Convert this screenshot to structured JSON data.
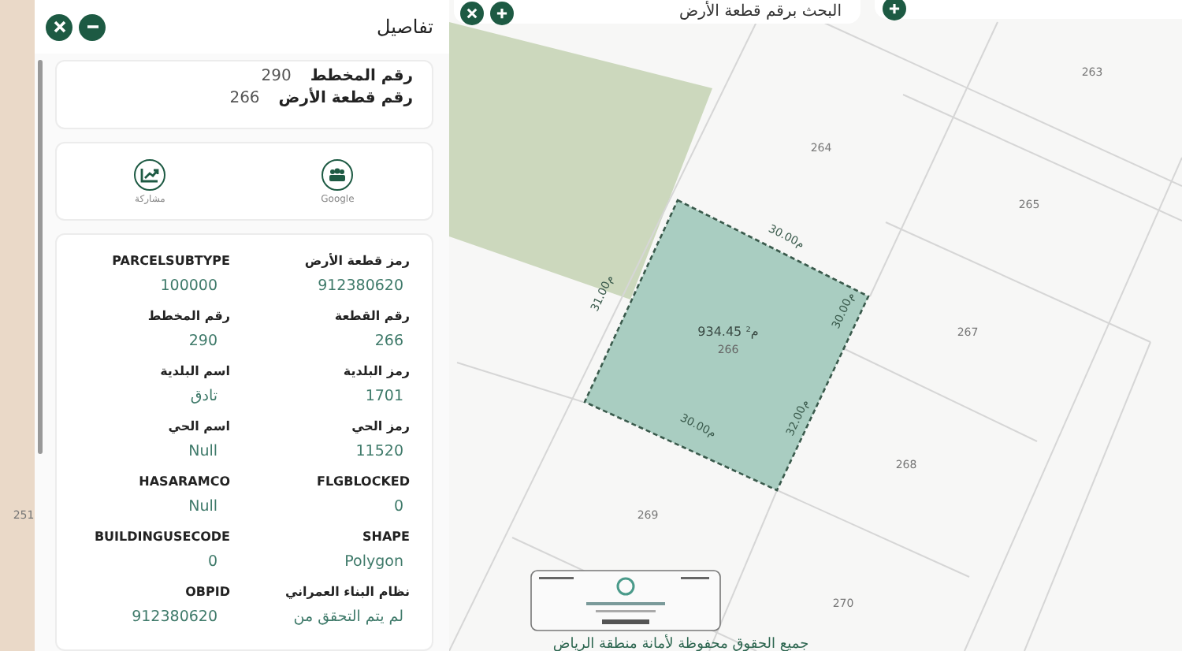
{
  "search_bar": {
    "title": "البحث برقم قطعة الأرض"
  },
  "map": {
    "parcels": [
      {
        "label": "263"
      },
      {
        "label": "264"
      },
      {
        "label": "265"
      },
      {
        "label": "267"
      },
      {
        "label": "268"
      },
      {
        "label": "269"
      },
      {
        "label": "270"
      },
      {
        "label": "251"
      }
    ],
    "selected_parcel": {
      "label": "266",
      "area": "934.45 م²",
      "edges": [
        "30.00م",
        "30.00م",
        "32.00م",
        "30.00م",
        "31.00م"
      ]
    },
    "footer": "جميع الحقوق محفوظة لأمانة منطقة الرياض"
  },
  "panel": {
    "title": "تفاصيل",
    "summary": [
      {
        "label": "رقم المخطط",
        "value": "290"
      },
      {
        "label": "رقم قطعة الأرض",
        "value": "266"
      }
    ],
    "actions": [
      {
        "label": "Google"
      },
      {
        "label": "مشاركة"
      }
    ],
    "attributes": [
      {
        "label": "رمز قطعة الأرض",
        "value": "912380620"
      },
      {
        "label": "PARCELSUBTYPE",
        "value": "100000"
      },
      {
        "label": "رقم القطعة",
        "value": "266"
      },
      {
        "label": "رقم المخطط",
        "value": "290"
      },
      {
        "label": "رمز البلدية",
        "value": "1701"
      },
      {
        "label": "اسم البلدية",
        "value": "تادق"
      },
      {
        "label": "رمز الحي",
        "value": "11520"
      },
      {
        "label": "اسم الحي",
        "value": "Null"
      },
      {
        "label": "FLGBLOCKED",
        "value": "0"
      },
      {
        "label": "HASARAMCO",
        "value": "Null"
      },
      {
        "label": "SHAPE",
        "value": "Polygon"
      },
      {
        "label": "BUILDINGUSECODE",
        "value": "0"
      },
      {
        "label": "نظام البناء العمراني",
        "value": "لم يتم التحقق من"
      },
      {
        "label": "OBPID",
        "value": "912380620"
      }
    ]
  }
}
